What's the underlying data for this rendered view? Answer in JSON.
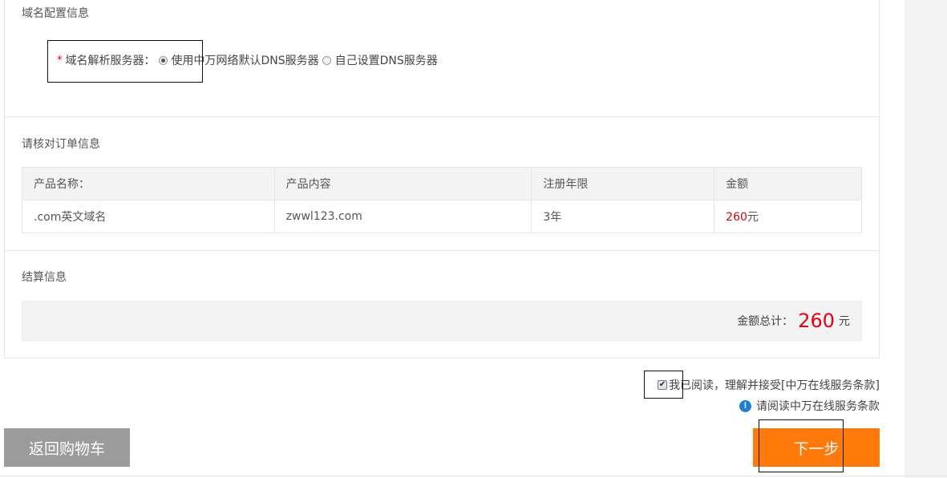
{
  "domain_config": {
    "section_title": "域名配置信息",
    "required_mark": "*",
    "dns_label": "域名解析服务器：",
    "dns_options": [
      {
        "label": "使用中万网络默认DNS服务器",
        "checked": true
      },
      {
        "label": "自己设置DNS服务器",
        "checked": false
      }
    ]
  },
  "order": {
    "section_title": "请核对订单信息",
    "headers": [
      "产品名称：",
      "产品内容",
      "注册年限",
      "金额"
    ],
    "row": {
      "product_name": ".com英文域名",
      "product_content": "zwwl123.com",
      "term": "3年",
      "price_value": "260",
      "price_unit": "元"
    }
  },
  "settlement": {
    "section_title": "结算信息",
    "total_label": "金额总计：",
    "total_value": "260",
    "total_unit": "元"
  },
  "agreement": {
    "checked": true,
    "text": "我已阅读，理解并接受[中万在线服务条款]",
    "notice": "请阅读中万在线服务条款"
  },
  "buttons": {
    "back": "返回购物车",
    "next": "下一步"
  },
  "colors": {
    "price_red": "#d0021b",
    "next_orange": "#ff7a0b",
    "back_gray": "#9b9b9b",
    "info_blue": "#1f7fd1"
  }
}
